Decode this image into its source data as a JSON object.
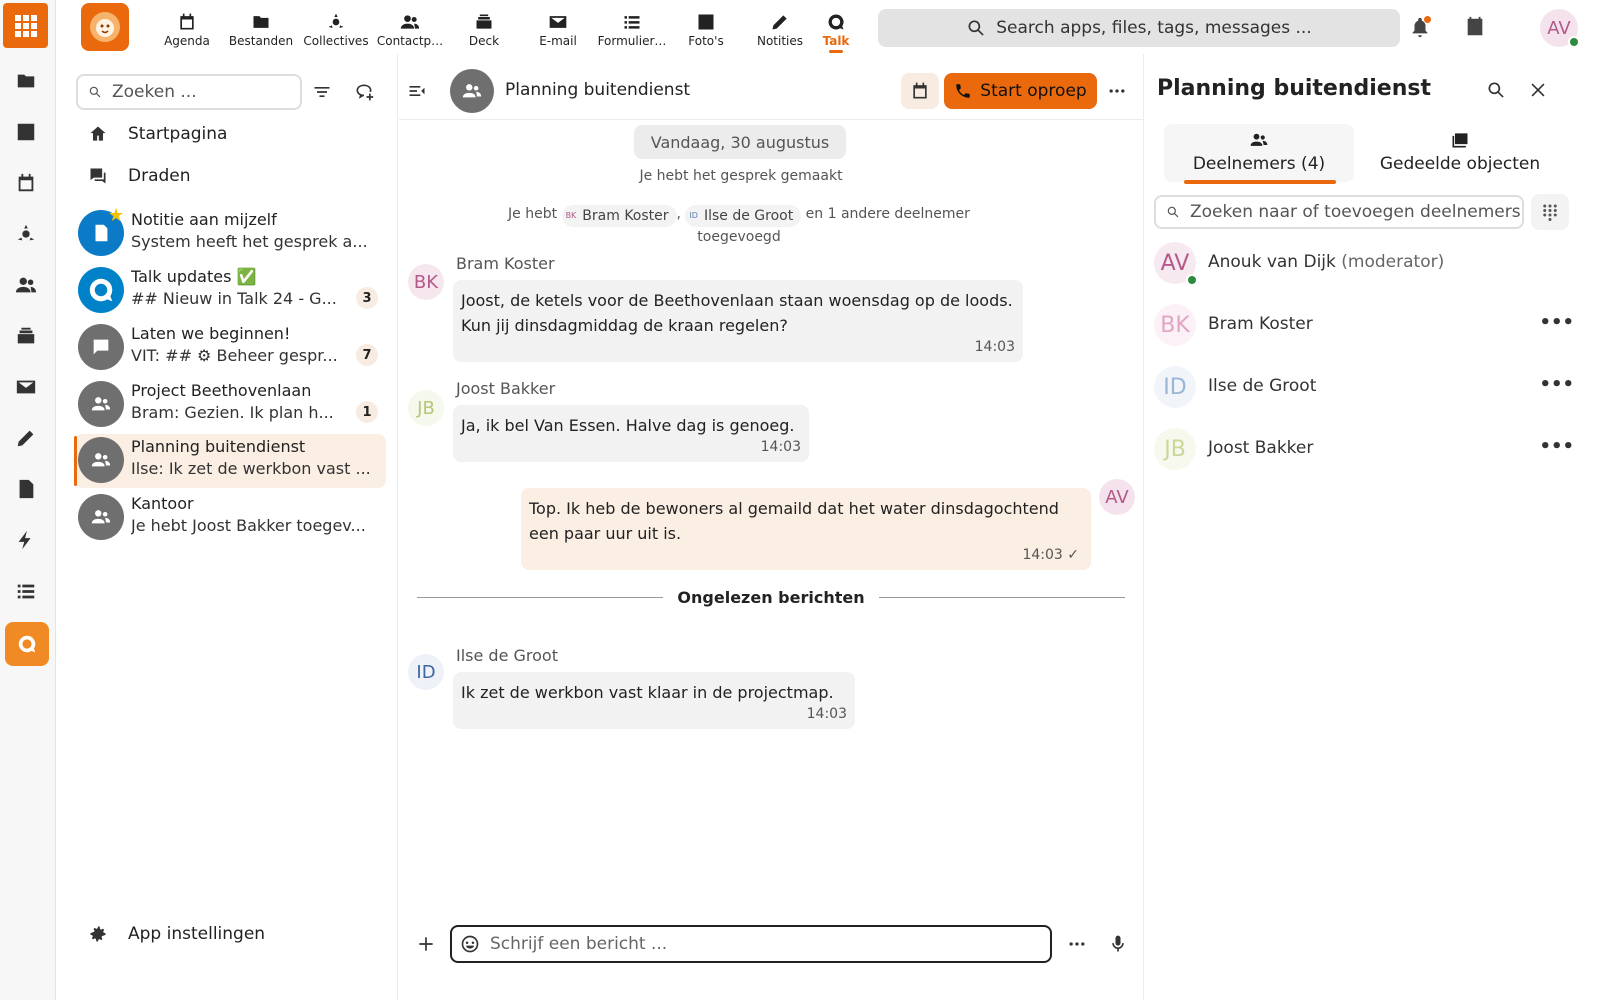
{
  "header": {
    "nav": [
      {
        "label": "Agenda",
        "icon": "calendar-icon"
      },
      {
        "label": "Bestanden",
        "icon": "folder-icon"
      },
      {
        "label": "Collectives",
        "icon": "collectives-icon"
      },
      {
        "label": "Contactp…",
        "icon": "contacts-icon"
      },
      {
        "label": "Deck",
        "icon": "deck-icon"
      },
      {
        "label": "E-mail",
        "icon": "mail-icon"
      },
      {
        "label": "Formulier…",
        "icon": "forms-icon"
      },
      {
        "label": "Foto's",
        "icon": "photos-icon"
      },
      {
        "label": "Notities",
        "icon": "notes-icon"
      },
      {
        "label": "Talk",
        "icon": "talk-icon",
        "active": true
      }
    ],
    "search_placeholder": "Search apps, files, tags, messages ...",
    "user_initials": "AV"
  },
  "sidebar": {
    "search_placeholder": "Zoeken ...",
    "home_label": "Startpagina",
    "threads_label": "Draden",
    "conversations": [
      {
        "name": "Notitie aan mijzelf",
        "sub": "System heeft het gesprek a...",
        "badge": ""
      },
      {
        "name": "Talk updates ✅",
        "sub": "## Nieuw in Talk 24 - G...",
        "badge": "3"
      },
      {
        "name": "Laten we beginnen!",
        "sub": "VIT: ## ⚙ Beheer gespr...",
        "badge": "7"
      },
      {
        "name": "Project Beethovenlaan",
        "sub": "Bram: Gezien. Ik plan h...",
        "badge": "1"
      },
      {
        "name": "Planning buitendienst",
        "sub": "Ilse: Ik zet de werkbon vast ...",
        "badge": "",
        "active": true
      },
      {
        "name": "Kantoor",
        "sub": "Je hebt Joost Bakker toegev...",
        "badge": ""
      }
    ],
    "settings_label": "App instellingen"
  },
  "chat": {
    "title": "Planning buitendienst",
    "call_label": "Start oproep",
    "date_label": "Vandaag, 30 augustus",
    "system_created": "Je hebt het gesprek gemaakt",
    "system_added": {
      "prefix": "Je hebt",
      "mention1": "Bram Koster",
      "mention1_initials": "BK",
      "separator": ",",
      "mention2": "Ilse de Groot",
      "mention2_initials": "ID",
      "suffix": "en 1 andere deelnemer",
      "line2": "toegevoegd"
    },
    "messages": [
      {
        "author": "Bram Koster",
        "initials": "BK",
        "text": "Joost, de ketels voor de Beethovenlaan staan woensdag op de loods. Kun jij dinsdagmiddag de kraan regelen?",
        "time": "14:03"
      },
      {
        "author": "Joost Bakker",
        "initials": "JB",
        "text": "Ja, ik bel Van Essen. Halve dag is genoeg.",
        "time": "14:03"
      },
      {
        "author": "",
        "initials": "AV",
        "text": "Top. Ik heb de bewoners al gemaild dat het water dinsdagochtend een paar uur uit is.",
        "time": "14:03 ✓",
        "own": true
      },
      {
        "author": "Ilse de Groot",
        "initials": "ID",
        "text": "Ik zet de werkbon vast klaar in de projectmap.",
        "time": "14:03"
      }
    ],
    "unread_label": "Ongelezen berichten",
    "composer_placeholder": "Schrijf een bericht ..."
  },
  "details": {
    "title": "Planning buitendienst",
    "tab_participants": "Deelnemers (4)",
    "tab_shared": "Gedeelde objecten",
    "search_placeholder": "Zoeken naar of toevoegen deelnemers",
    "participants": [
      {
        "name": "Anouk van Dijk",
        "role": "(moderator)",
        "initials": "AV",
        "color": "#b45a8a",
        "bg": "#f6eaf0"
      },
      {
        "name": "Bram Koster",
        "role": "",
        "initials": "BK",
        "color": "#e3a5c4",
        "bg": "#fbf1f6"
      },
      {
        "name": "Ilse de Groot",
        "role": "",
        "initials": "ID",
        "color": "#9bb5d6",
        "bg": "#f1f5fa"
      },
      {
        "name": "Joost Bakker",
        "role": "",
        "initials": "JB",
        "color": "#c9d79a",
        "bg": "#f7f9ee"
      }
    ]
  }
}
